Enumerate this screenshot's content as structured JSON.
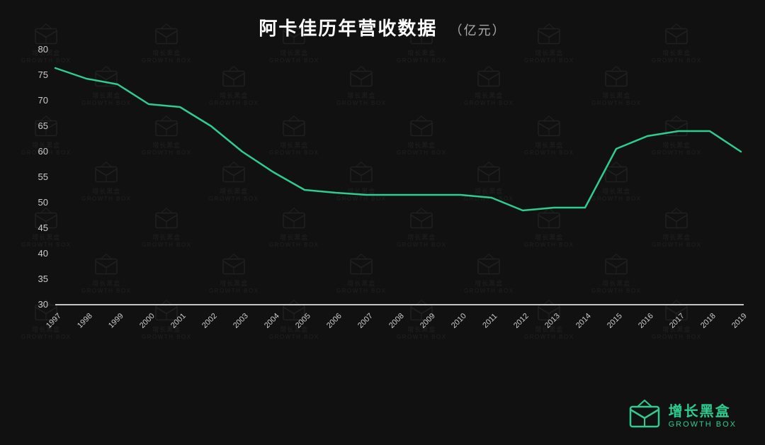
{
  "chart": {
    "title": "阿卡佳历年营收数据",
    "unit": "（亿元）",
    "background_color": "#111111",
    "line_color": "#2ecc8f",
    "axis_color": "#ffffff",
    "y_axis": {
      "min": 30,
      "max": 80,
      "step": 5,
      "labels": [
        30,
        35,
        40,
        45,
        50,
        55,
        60,
        65,
        70,
        75,
        80
      ]
    },
    "x_axis": {
      "labels": [
        "1997",
        "1998",
        "1999",
        "2000",
        "2001",
        "2002",
        "2003",
        "2004",
        "2005",
        "2006",
        "2007",
        "2008",
        "2009",
        "2010",
        "2011",
        "2012",
        "2013",
        "2014",
        "2015",
        "2016",
        "2017",
        "2018",
        "2019"
      ]
    },
    "data_points": [
      {
        "year": "1997",
        "value": 76.5
      },
      {
        "year": "1998",
        "value": 74.5
      },
      {
        "year": "1999",
        "value": 73.5
      },
      {
        "year": "2000",
        "value": 69.5
      },
      {
        "year": "2001",
        "value": 69.0
      },
      {
        "year": "2002",
        "value": 65.0
      },
      {
        "year": "2003",
        "value": 60.0
      },
      {
        "year": "2004",
        "value": 56.0
      },
      {
        "year": "2005",
        "value": 52.5
      },
      {
        "year": "2006",
        "value": 52.0
      },
      {
        "year": "2007",
        "value": 51.5
      },
      {
        "year": "2008",
        "value": 51.5
      },
      {
        "year": "2009",
        "value": 51.5
      },
      {
        "year": "2010",
        "value": 51.5
      },
      {
        "year": "2011",
        "value": 51.0
      },
      {
        "year": "2012",
        "value": 48.5
      },
      {
        "year": "2013",
        "value": 49.0
      },
      {
        "year": "2014",
        "value": 49.0
      },
      {
        "year": "2015",
        "value": 60.5
      },
      {
        "year": "2016",
        "value": 63.0
      },
      {
        "year": "2017",
        "value": 64.0
      },
      {
        "year": "2018",
        "value": 64.0
      },
      {
        "year": "2019",
        "value": 60.0
      }
    ]
  },
  "brand": {
    "chinese": "增长黑盒",
    "english": "GROWTH BOX"
  },
  "watermark": {
    "chinese": "增长黑盒",
    "english": "GROWTH BOX"
  }
}
